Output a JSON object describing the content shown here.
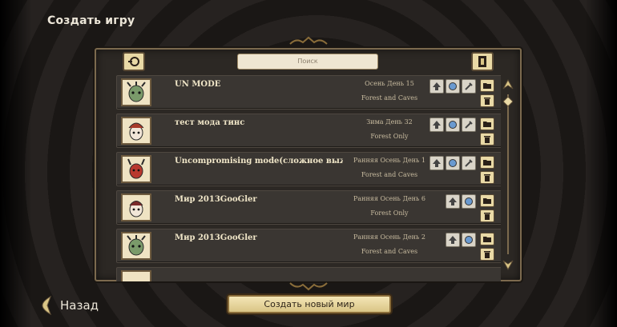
{
  "header": {
    "title": "Создать игру"
  },
  "search": {
    "placeholder": "Поиск"
  },
  "rows": [
    {
      "name": "UN MODE",
      "season": "Осень День 15",
      "world": "Forest and Caves"
    },
    {
      "name": "тест мода тинс",
      "season": "Зима День 32",
      "world": "Forest Only"
    },
    {
      "name": "Uncompromising mode(сложное выжива...",
      "season": "Ранняя Осень День 1",
      "world": "Forest and Caves"
    },
    {
      "name": "Мир 2013GooGler",
      "season": "Ранняя Осень День 6",
      "world": "Forest Only"
    },
    {
      "name": "Мир 2013GooGler",
      "season": "Ранняя Осень День 2",
      "world": "Forest and Caves"
    }
  ],
  "footer": {
    "back_label": "Назад",
    "create_label": "Создать новый мир"
  },
  "colors": {
    "panel": "#2c2824",
    "border": "#7c6a4e",
    "button": "#e9d9a6"
  }
}
